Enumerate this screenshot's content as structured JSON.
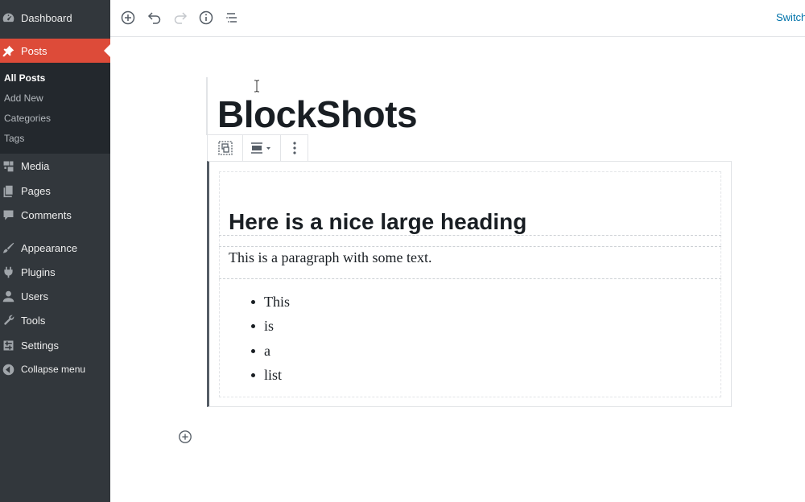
{
  "sidebar": {
    "items": [
      {
        "label": "Dashboard",
        "icon": "dashboard-icon"
      },
      {
        "label": "Posts",
        "icon": "pin-icon",
        "active": true
      },
      {
        "label": "Media",
        "icon": "media-icon"
      },
      {
        "label": "Pages",
        "icon": "pages-icon"
      },
      {
        "label": "Comments",
        "icon": "comment-icon"
      },
      {
        "label": "Appearance",
        "icon": "brush-icon"
      },
      {
        "label": "Plugins",
        "icon": "plug-icon"
      },
      {
        "label": "Users",
        "icon": "user-icon"
      },
      {
        "label": "Tools",
        "icon": "wrench-icon"
      },
      {
        "label": "Settings",
        "icon": "settings-icon"
      },
      {
        "label": "Collapse menu",
        "icon": "collapse-icon"
      }
    ],
    "submenu": [
      "All Posts",
      "Add New",
      "Categories",
      "Tags"
    ],
    "accent_color": "#dd4b39"
  },
  "toolbar": {
    "icons": [
      "add-block-icon",
      "undo-icon",
      "redo-icon",
      "info-icon",
      "outline-icon"
    ],
    "switch_label": "Switch"
  },
  "editor": {
    "post_title": "BlockShots",
    "block_toolbar": [
      "group-icon",
      "align-icon",
      "more-options-icon"
    ],
    "inner_heading": "Here is a nice large heading",
    "paragraph": "This is a paragraph with some text.",
    "list": [
      "This",
      "is",
      "a",
      "list"
    ]
  }
}
